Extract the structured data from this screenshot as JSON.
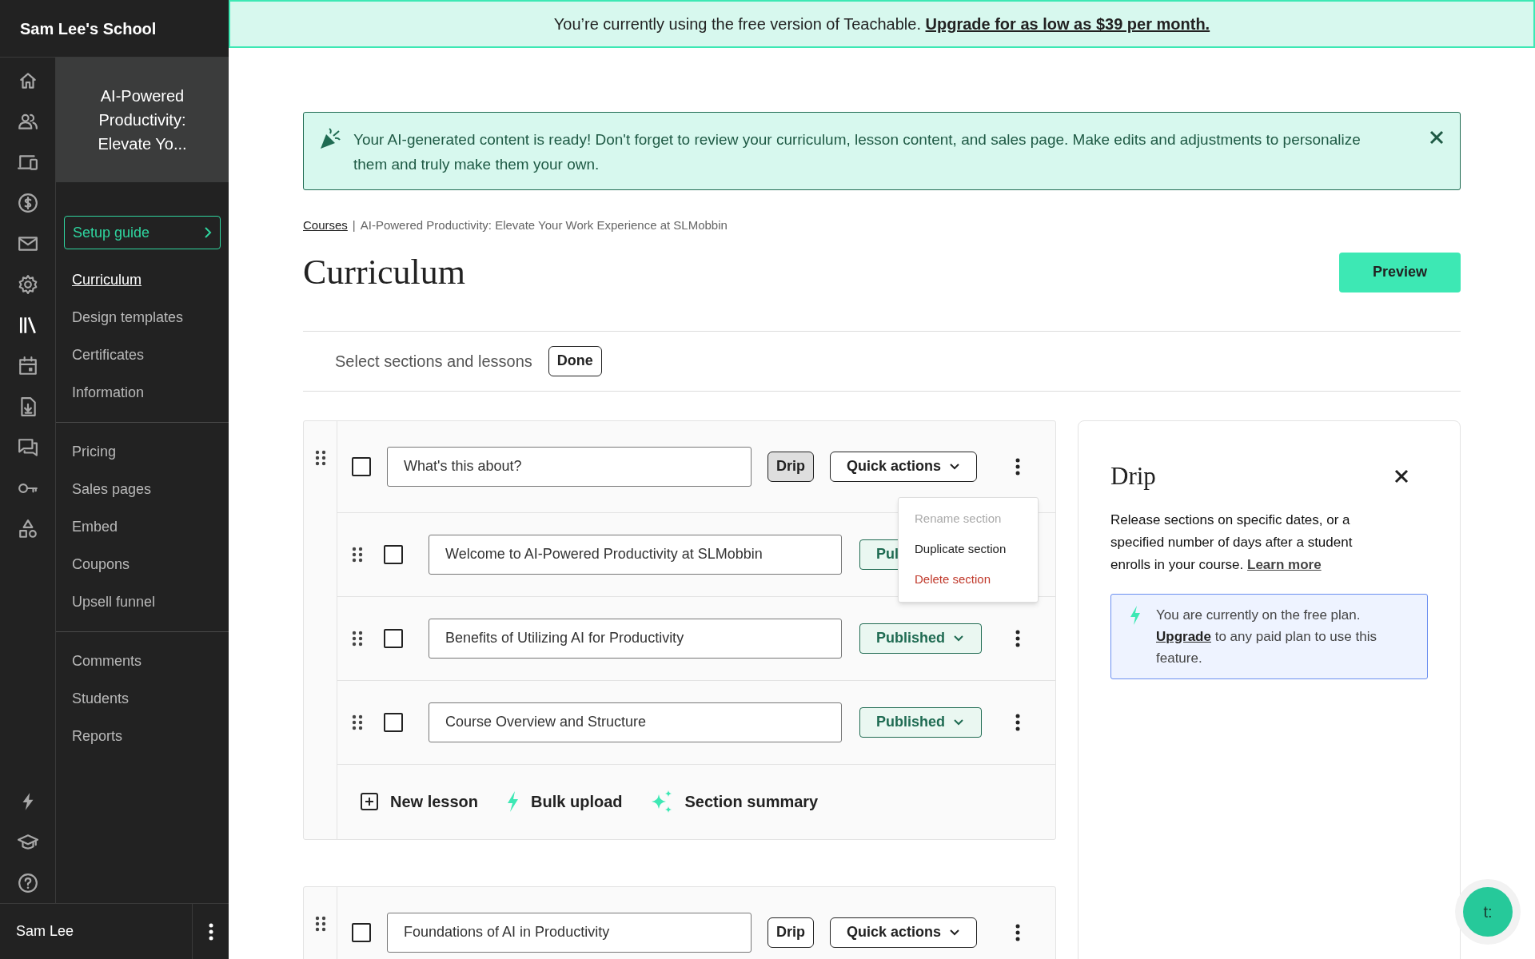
{
  "sidebar": {
    "school": "Sam Lee's School",
    "rail_icons": [
      {
        "kind": "home",
        "selected": false
      },
      {
        "kind": "users",
        "selected": false
      },
      {
        "kind": "devices",
        "selected": false
      },
      {
        "kind": "dollar",
        "selected": false
      },
      {
        "kind": "mail",
        "selected": false
      },
      {
        "kind": "gear",
        "selected": false
      },
      {
        "kind": "library",
        "selected": true
      },
      {
        "kind": "calendar",
        "selected": false
      },
      {
        "kind": "download",
        "selected": false
      },
      {
        "kind": "chat",
        "selected": false
      },
      {
        "kind": "key",
        "selected": false
      },
      {
        "kind": "shapes",
        "selected": false
      }
    ],
    "rail_bottom_icons": [
      {
        "kind": "bolt",
        "selected": false
      },
      {
        "kind": "cap",
        "selected": false
      },
      {
        "kind": "help",
        "selected": false
      }
    ],
    "course_title": "AI-Powered Productivity: Elevate Yo...",
    "setup_guide": "Setup guide",
    "nav_groups": [
      [
        {
          "label": "Curriculum",
          "selected": true
        },
        {
          "label": "Design templates",
          "selected": false
        },
        {
          "label": "Certificates",
          "selected": false
        },
        {
          "label": "Information",
          "selected": false
        }
      ],
      [
        {
          "label": "Pricing",
          "selected": false
        },
        {
          "label": "Sales pages",
          "selected": false
        },
        {
          "label": "Embed",
          "selected": false
        },
        {
          "label": "Coupons",
          "selected": false
        },
        {
          "label": "Upsell funnel",
          "selected": false
        }
      ],
      [
        {
          "label": "Comments",
          "selected": false
        },
        {
          "label": "Students",
          "selected": false
        },
        {
          "label": "Reports",
          "selected": false
        }
      ]
    ],
    "user": "Sam Lee"
  },
  "banner": {
    "text": "You’re currently using the free version of Teachable.",
    "link": "Upgrade for as low as $39 per month."
  },
  "alert": {
    "text": "Your AI-generated content is ready! Don't forget to review your curriculum, lesson content, and sales page. Make edits and adjustments to personalize them and truly make them your own."
  },
  "breadcrumb": {
    "link": "Courses",
    "separator": "|",
    "current": "AI-Powered Productivity: Elevate Your Work Experience at SLMobbin"
  },
  "title": "Curriculum",
  "preview": "Preview",
  "select_bar": {
    "label": "Select sections and lessons",
    "done": "Done"
  },
  "sections": [
    {
      "title": "What's this about?",
      "checked": false,
      "drip": "Drip",
      "drip_selected": true,
      "quick_actions": "Quick actions",
      "menu": [
        {
          "label": "Rename section",
          "kind": "disabled"
        },
        {
          "label": "Duplicate section",
          "kind": "normal"
        },
        {
          "label": "Delete section",
          "kind": "danger"
        }
      ],
      "lessons": [
        {
          "title": "Welcome to AI-Powered Productivity at SLMobbin",
          "checked": false,
          "status": "Pul"
        },
        {
          "title": "Benefits of Utilizing AI for Productivity",
          "checked": false,
          "status": "Published"
        },
        {
          "title": "Course Overview and Structure",
          "checked": false,
          "status": "Published"
        }
      ],
      "footer": [
        {
          "kind": "plus",
          "label": "New lesson"
        },
        {
          "kind": "bolt",
          "label": "Bulk upload"
        },
        {
          "kind": "sparkle",
          "label": "Section summary"
        }
      ]
    },
    {
      "title": "Foundations of AI in Productivity",
      "checked": false,
      "drip": "Drip",
      "drip_selected": false,
      "quick_actions": "Quick actions"
    }
  ],
  "drip_panel": {
    "title": "Drip",
    "text": "Release sections on specific dates, or a specified number of days after a student enrolls in your course.",
    "link": "Learn more",
    "notice": {
      "before": "You are currently on the free plan.",
      "link": "Upgrade",
      "after": "to any paid plan to use this feature."
    }
  },
  "fab": "t:"
}
